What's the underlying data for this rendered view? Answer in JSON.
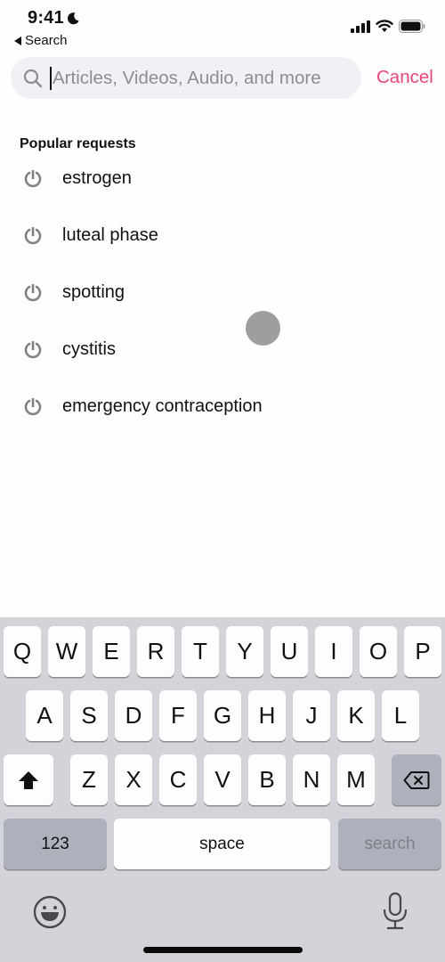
{
  "status_bar": {
    "time": "9:41",
    "back_app_label": "Search",
    "icons": [
      "moon-icon",
      "cellular-signal-icon",
      "wifi-icon",
      "battery-icon"
    ]
  },
  "search": {
    "placeholder": "Articles, Videos, Audio, and more",
    "value": "",
    "cancel_label": "Cancel",
    "accent_color": "#e8457e"
  },
  "popular": {
    "title": "Popular requests",
    "items": [
      {
        "label": "estrogen",
        "icon": "trending-icon"
      },
      {
        "label": "luteal phase",
        "icon": "trending-icon"
      },
      {
        "label": "spotting",
        "icon": "trending-icon"
      },
      {
        "label": "cystitis",
        "icon": "trending-icon"
      },
      {
        "label": "emergency contraception",
        "icon": "trending-icon"
      }
    ]
  },
  "keyboard": {
    "row1": [
      "Q",
      "W",
      "E",
      "R",
      "T",
      "Y",
      "U",
      "I",
      "O",
      "P"
    ],
    "row2": [
      "A",
      "S",
      "D",
      "F",
      "G",
      "H",
      "J",
      "K",
      "L"
    ],
    "row3": [
      "Z",
      "X",
      "C",
      "V",
      "B",
      "N",
      "M"
    ],
    "numbers_label": "123",
    "space_label": "space",
    "return_label": "search"
  }
}
